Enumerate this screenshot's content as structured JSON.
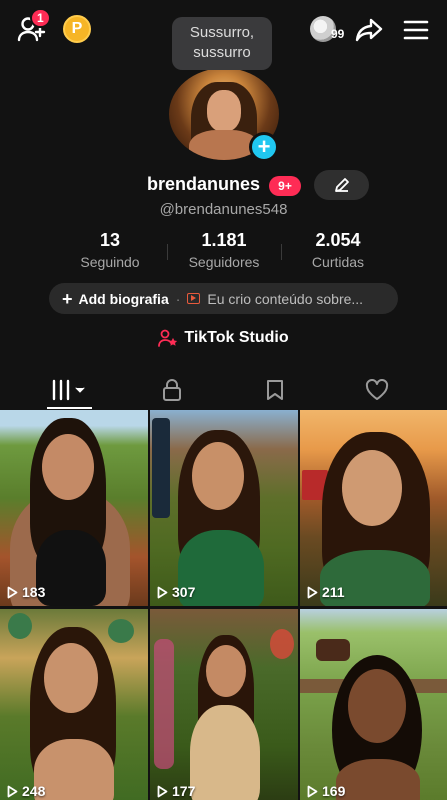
{
  "topbar": {
    "notification_count": "1",
    "coin_label": "P",
    "tooltip_text": "Sussurro, sussurro",
    "story_count": "99"
  },
  "profile": {
    "username": "brendanunes",
    "badge": "9+",
    "handle": "@brendanunes548"
  },
  "stats": [
    {
      "value": "13",
      "label": "Seguindo"
    },
    {
      "value": "1.181",
      "label": "Seguidores"
    },
    {
      "value": "2.054",
      "label": "Curtidas"
    }
  ],
  "bio": {
    "add_label": "Add biografia",
    "separator": "·",
    "description": "Eu crio conteúdo sobre..."
  },
  "studio": {
    "label": "TikTok Studio"
  },
  "videos": [
    {
      "views": "183"
    },
    {
      "views": "307"
    },
    {
      "views": "211"
    },
    {
      "views": "248"
    },
    {
      "views": "177"
    },
    {
      "views": "169"
    }
  ],
  "colors": {
    "background": "#121212",
    "accent_red": "#fe2c55",
    "avatar_plus": "#20c7f0",
    "coin": "#f6b526"
  }
}
